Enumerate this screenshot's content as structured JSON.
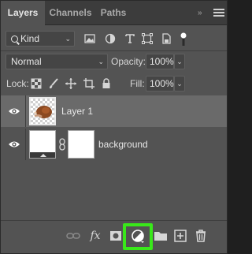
{
  "tabs": [
    {
      "label": "Layers",
      "active": true
    },
    {
      "label": "Channels",
      "active": false
    },
    {
      "label": "Paths",
      "active": false
    }
  ],
  "header": {
    "collapse_glyph": "»",
    "menu_icon": "hamburger-menu-icon"
  },
  "filter": {
    "kind_label": "Kind",
    "icons": [
      "pixel-filter-icon",
      "adjustment-filter-icon",
      "type-filter-icon",
      "shape-filter-icon",
      "smart-object-filter-icon",
      "filter-toggle-icon"
    ]
  },
  "blend": {
    "mode": "Normal",
    "opacity_label": "Opacity:",
    "opacity_value": "100%"
  },
  "lock": {
    "label": "Lock:",
    "icons": [
      "lock-transparent-icon",
      "lock-image-icon",
      "lock-position-icon",
      "artboard-lock-icon",
      "lock-all-icon"
    ],
    "fill_label": "Fill:",
    "fill_value": "100%"
  },
  "layers": [
    {
      "name": "Layer 1",
      "visible": true,
      "selected": true
    },
    {
      "name": "background",
      "visible": true,
      "selected": false,
      "has_mask": true
    }
  ],
  "bottom_toolbar": {
    "icons": [
      "link-layers-icon",
      "fx-icon",
      "add-mask-icon",
      "adjustment-layer-icon",
      "group-folder-icon",
      "new-layer-icon",
      "trash-icon"
    ],
    "fx_label": "fx",
    "highlight_color": "#39e81a"
  },
  "colors": {
    "panel_bg": "#535353",
    "selected_row": "#6a6a6a",
    "tab_bar": "#3c3c3c",
    "highlight": "#39e81a"
  }
}
